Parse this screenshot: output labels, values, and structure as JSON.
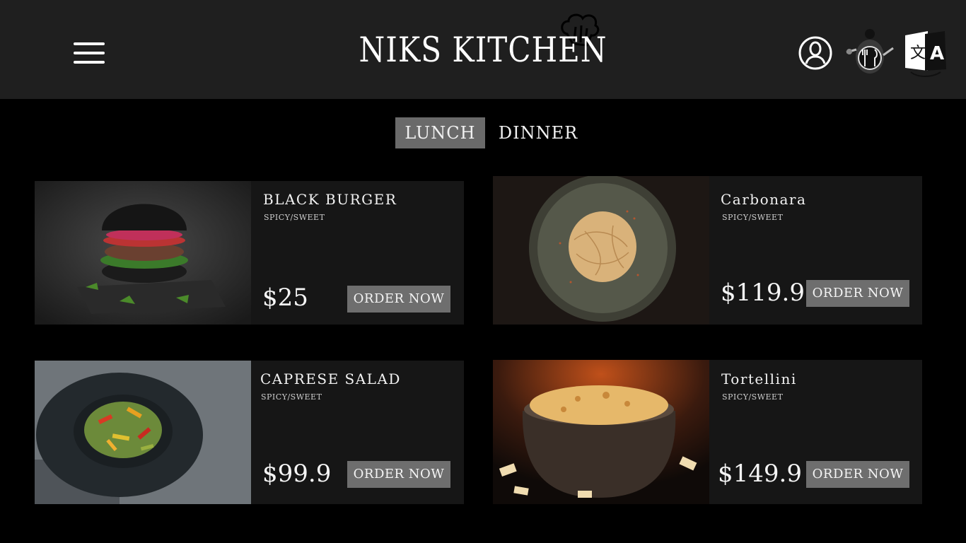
{
  "header": {
    "brand": "NIKS KITCHEN"
  },
  "tabs": [
    {
      "label": "LUNCH",
      "active": true
    },
    {
      "label": "DINNER",
      "active": false
    }
  ],
  "items": [
    {
      "name": "BLACK  BURGER",
      "subtitle": "SPICY/SWEET",
      "price": "$25",
      "button": "ORDER NOW"
    },
    {
      "name": "Carbonara",
      "subtitle": "SPICY/SWEET",
      "price": "$119.9",
      "button": "ORDER NOW"
    },
    {
      "name": "CAPRESE  SALAD",
      "subtitle": "SPICY/SWEET",
      "price": "$99.9",
      "button": "ORDER NOW"
    },
    {
      "name": "Tortellini",
      "subtitle": "SPICY/SWEET",
      "price": "$149.9",
      "button": "ORDER NOW"
    }
  ],
  "colors": {
    "header_bg": "#1f1f1f",
    "page_bg": "#000000",
    "card_bg": "#161616",
    "button_bg": "#6e6e6e",
    "active_tab_bg": "#6a6a6a"
  }
}
